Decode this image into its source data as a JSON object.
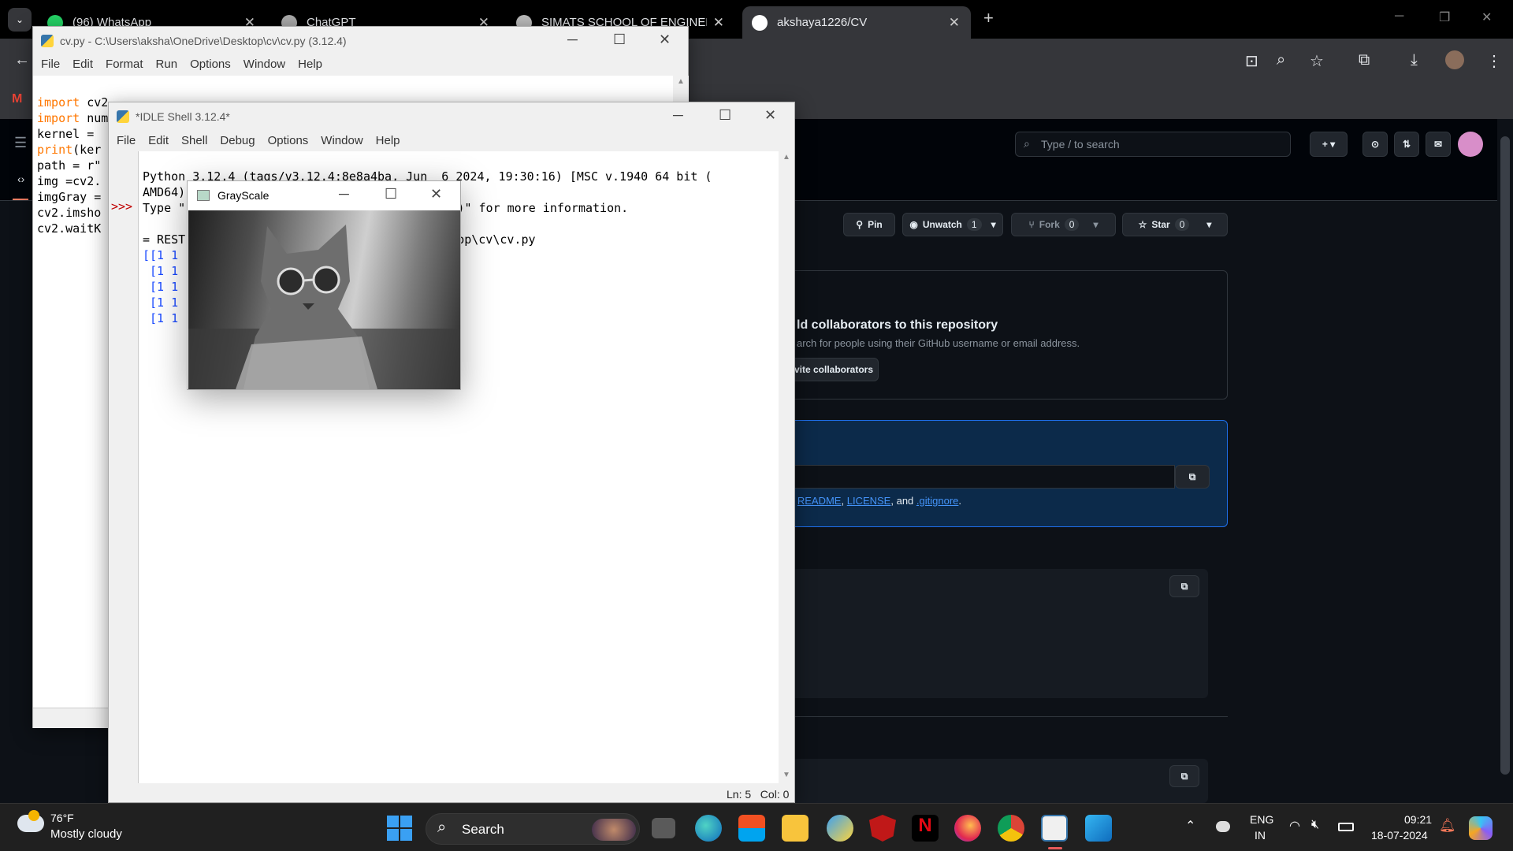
{
  "browser": {
    "tabs": [
      {
        "title": "(96) WhatsApp",
        "color": "#25d366"
      },
      {
        "title": "ChatGPT",
        "color": "#aaaaaa"
      },
      {
        "title": "SIMATS SCHOOL OF ENGINEERI",
        "color": "#bbbbbb"
      },
      {
        "title": "akshaya1226/CV",
        "color": "#ffffff"
      }
    ],
    "new_tab": "+"
  },
  "github": {
    "search_placeholder": "Type / to search",
    "pin": "Pin",
    "unwatch": "Unwatch",
    "unwatch_count": "1",
    "fork": "Fork",
    "fork_count": "0",
    "star": "Star",
    "star_count": "0",
    "collab_heading": "ld collaborators to this repository",
    "collab_sub": "arch for people using their GitHub username or email address.",
    "invite_btn": "vite collaborators",
    "quicksetup_prefix": "a",
    "readme": "README",
    "license": "LICENSE",
    "and": ", and",
    "gitignore": ".gitignore",
    "period": "."
  },
  "editor": {
    "title": "cv.py - C:\\Users\\aksha\\OneDrive\\Desktop\\cv\\cv.py (3.12.4)",
    "menu": [
      "File",
      "Edit",
      "Format",
      "Run",
      "Options",
      "Window",
      "Help"
    ],
    "lines": [
      {
        "kw": "import",
        "rest": " cv2"
      },
      {
        "kw": "import",
        "rest": " numpy as np"
      },
      {
        "kw": "",
        "rest": "kernel = "
      },
      {
        "kw": "print",
        "rest": "(ker"
      },
      {
        "kw": "",
        "rest": "path = r\""
      },
      {
        "kw": "",
        "rest": "img =cv2."
      },
      {
        "kw": "",
        "rest": "imgGray ="
      },
      {
        "kw": "",
        "rest": "cv2.imsho"
      },
      {
        "kw": "",
        "rest": "cv2.waitK"
      }
    ]
  },
  "shell": {
    "title": "*IDLE Shell 3.12.4*",
    "menu": [
      "File",
      "Edit",
      "Shell",
      "Debug",
      "Options",
      "Window",
      "Help"
    ],
    "line1": "Python 3.12.4 (tags/v3.12.4:8e8a4ba, Jun  6 2024, 19:30:16) [MSC v.1940 64 bit (",
    "line2": "AMD64)] on win32",
    "line3a": "Type \"",
    "line3b": "license()\" for more information.",
    "prompt": ">>>",
    "restart_a": "= REST",
    "restart_b": "op\\cv\\cv.py",
    "out_lines": [
      "[[1 1",
      " [1 1",
      " [1 1",
      " [1 1",
      " [1 1"
    ],
    "status": "Ln: 5   Col: 0"
  },
  "grayscale": {
    "title": "GrayScale"
  },
  "taskbar": {
    "temp": "76°F",
    "weather": "Mostly cloudy",
    "search": "Search",
    "lang1": "ENG",
    "lang2": "IN",
    "time": "09:21",
    "date": "18-07-2024"
  }
}
